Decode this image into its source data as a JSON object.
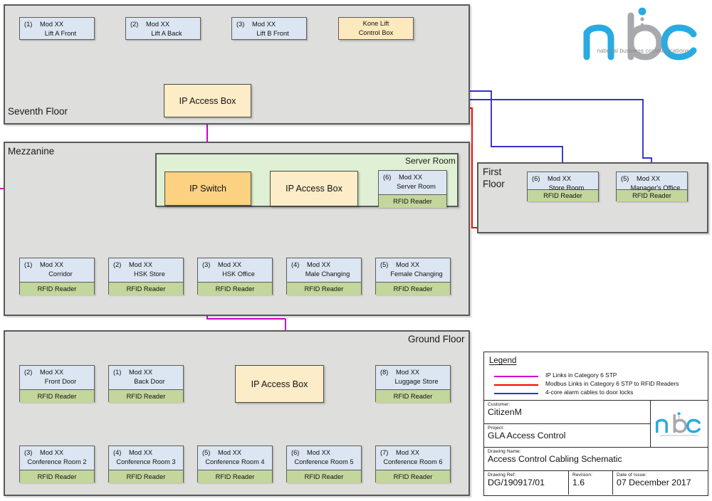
{
  "logo": {
    "tagline": "national business communications",
    "letters": "nbc",
    "blue": "#29ABE2",
    "grey": "#A7A9AC"
  },
  "colors": {
    "ip_link": "#CC00CC",
    "modbus": "#FF0000",
    "alarm": "#3333CC",
    "floor_bg": "#DEDEDD",
    "room_bg": "#DFF0D4",
    "device_bg": "#DCE6F2",
    "reader_bg": "#C3D69B",
    "access_box": "#FDECC8",
    "switch_box": "#FCD182"
  },
  "floors": [
    {
      "id": "seventh",
      "label": "Seventh Floor",
      "devices": [
        {
          "idx": "(1)",
          "mod": "Mod XX",
          "name": "Lift A Front",
          "reader": null
        },
        {
          "idx": "(2)",
          "mod": "Mod XX",
          "name": "Lift A Back",
          "reader": null
        },
        {
          "idx": "(3)",
          "mod": "Mod XX",
          "name": "Lift B Front",
          "reader": null
        }
      ],
      "kone": {
        "line1": "Kone Lift",
        "line2": "Control Box"
      },
      "access_box": "IP Access Box"
    },
    {
      "id": "mezzanine",
      "label": "Mezzanine",
      "room_label": "Server Room",
      "switch": "IP Switch",
      "access_box": "IP Access Box",
      "server_device": {
        "idx": "(6)",
        "mod": "Mod XX",
        "name": "Server Room",
        "reader": "RFID Reader"
      },
      "devices": [
        {
          "idx": "(1)",
          "mod": "Mod XX",
          "name": "Corridor",
          "reader": "RFID Reader"
        },
        {
          "idx": "(2)",
          "mod": "Mod XX",
          "name": "HSK Store",
          "reader": "RFID Reader"
        },
        {
          "idx": "(3)",
          "mod": "Mod XX",
          "name": "HSK Office",
          "reader": "RFID Reader"
        },
        {
          "idx": "(4)",
          "mod": "Mod XX",
          "name": "Male Changing",
          "reader": "RFID Reader"
        },
        {
          "idx": "(5)",
          "mod": "Mod XX",
          "name": "Female Changing",
          "reader": "RFID Reader"
        }
      ]
    },
    {
      "id": "first",
      "label": "First\nFloor",
      "devices": [
        {
          "idx": "(6)",
          "mod": "Mod XX",
          "name": "Store Room",
          "reader": "RFID Reader"
        },
        {
          "idx": "(5)",
          "mod": "Mod XX",
          "name": "Manager's Office",
          "reader": "RFID Reader"
        }
      ]
    },
    {
      "id": "ground",
      "label": "Ground Floor",
      "access_box": "IP Access Box",
      "devices_top": [
        {
          "idx": "(2)",
          "mod": "Mod XX",
          "name": "Front Door",
          "reader": "RFID Reader"
        },
        {
          "idx": "(1)",
          "mod": "Mod XX",
          "name": "Back Door",
          "reader": "RFID Reader"
        },
        {
          "idx": "(8)",
          "mod": "Mod XX",
          "name": "Luggage Store",
          "reader": "RFID Reader"
        }
      ],
      "devices_bottom": [
        {
          "idx": "(3)",
          "mod": "Mod XX",
          "name": "Conference Room 2",
          "reader": "RFID Reader"
        },
        {
          "idx": "(4)",
          "mod": "Mod XX",
          "name": "Conference Room 3",
          "reader": "RFID Reader"
        },
        {
          "idx": "(5)",
          "mod": "Mod XX",
          "name": "Conference Room 4",
          "reader": "RFID Reader"
        },
        {
          "idx": "(6)",
          "mod": "Mod XX",
          "name": "Conference Room 5",
          "reader": "RFID Reader"
        },
        {
          "idx": "(7)",
          "mod": "Mod XX",
          "name": "Conference Room 6",
          "reader": "RFID Reader"
        }
      ]
    }
  ],
  "legend": {
    "title": "Legend",
    "items": [
      {
        "color": "#CC00CC",
        "text": "IP Links in Category 6 STP"
      },
      {
        "color": "#FF0000",
        "text": "Modbus Links in Category 6 STP to RFID Readers"
      },
      {
        "color": "#3333CC",
        "text": "4-core alarm cables to door locks"
      }
    ]
  },
  "titleblock": {
    "customer_caption": "Customer:",
    "customer": "CitizenM",
    "project_caption": "Project:",
    "project": "GLA Access Control",
    "drawing_name_caption": "Drawing Name:",
    "drawing_name": "Access Control Cabling Schematic",
    "drawing_ref_caption": "Drawing Ref:",
    "drawing_ref": "DG/190917/01",
    "revision_caption": "Revision:",
    "revision": "1.6",
    "date_caption": "Date of Issue:",
    "date": "07 December 2017"
  }
}
